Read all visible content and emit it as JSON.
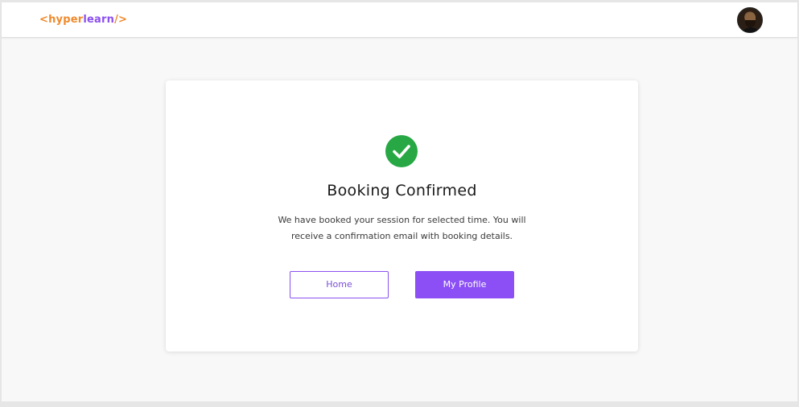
{
  "header": {
    "logo_open": "<hyper",
    "logo_learn": "learn",
    "logo_close": "/>"
  },
  "confirmation": {
    "title": "Booking Confirmed",
    "message": "We have booked your session for selected time. You will receive a confirmation email with booking details."
  },
  "actions": {
    "home_label": "Home",
    "profile_label": "My Profile"
  },
  "icons": {
    "status": "check-circle-icon",
    "user": "avatar"
  },
  "colors": {
    "brand_orange": "#f08a2c",
    "brand_purple": "#8b4ff5",
    "success_green": "#27a844"
  }
}
